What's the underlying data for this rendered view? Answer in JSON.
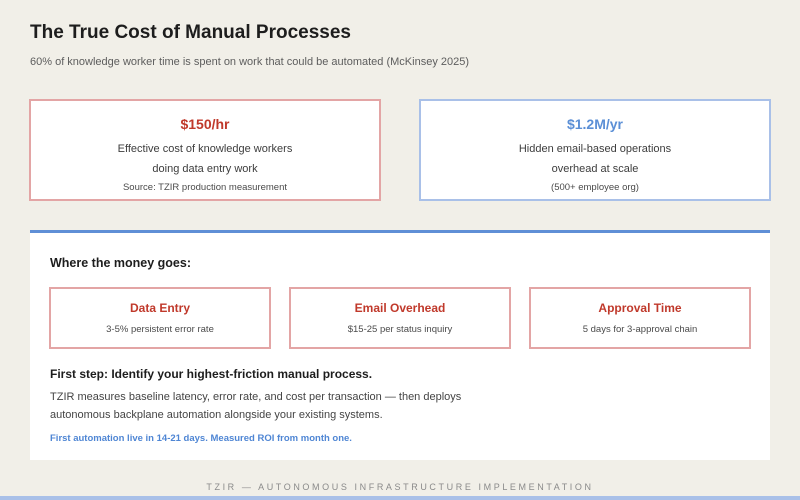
{
  "header": {
    "title": "The True Cost of Manual Processes",
    "subtitle": "60% of knowledge worker time is spent on work that could be automated (McKinsey 2025)"
  },
  "stats": [
    {
      "value": "$150/hr",
      "desc_line1": "Effective cost of knowledge workers",
      "desc_line2": "doing data entry work",
      "note": "Source: TZIR production measurement"
    },
    {
      "value": "$1.2M/yr",
      "desc_line1": "Hidden email-based operations",
      "desc_line2": "overhead at scale",
      "note": "(500+ employee org)"
    }
  ],
  "breakdown": {
    "heading": "Where the money goes:",
    "items": [
      {
        "title": "Data Entry",
        "desc": "3-5% persistent error rate"
      },
      {
        "title": "Email Overhead",
        "desc": "$15-25 per status inquiry"
      },
      {
        "title": "Approval Time",
        "desc": "5 days for 3-approval chain"
      }
    ],
    "step_heading": "First step: Identify your highest-friction manual process.",
    "step_body": "TZIR measures baseline latency, error rate, and cost per transaction — then deploys autonomous backplane automation alongside your existing systems.",
    "cta": "First automation live in 14-21 days. Measured ROI from month one."
  },
  "footer": "TZIR — AUTONOMOUS INFRASTRUCTURE IMPLEMENTATION",
  "colors": {
    "background": "#f1efe8",
    "accent_red": "#c0392b",
    "accent_blue": "#5b8fd6",
    "border_red": "#e3a5a5",
    "border_blue": "#a9c0e8"
  }
}
